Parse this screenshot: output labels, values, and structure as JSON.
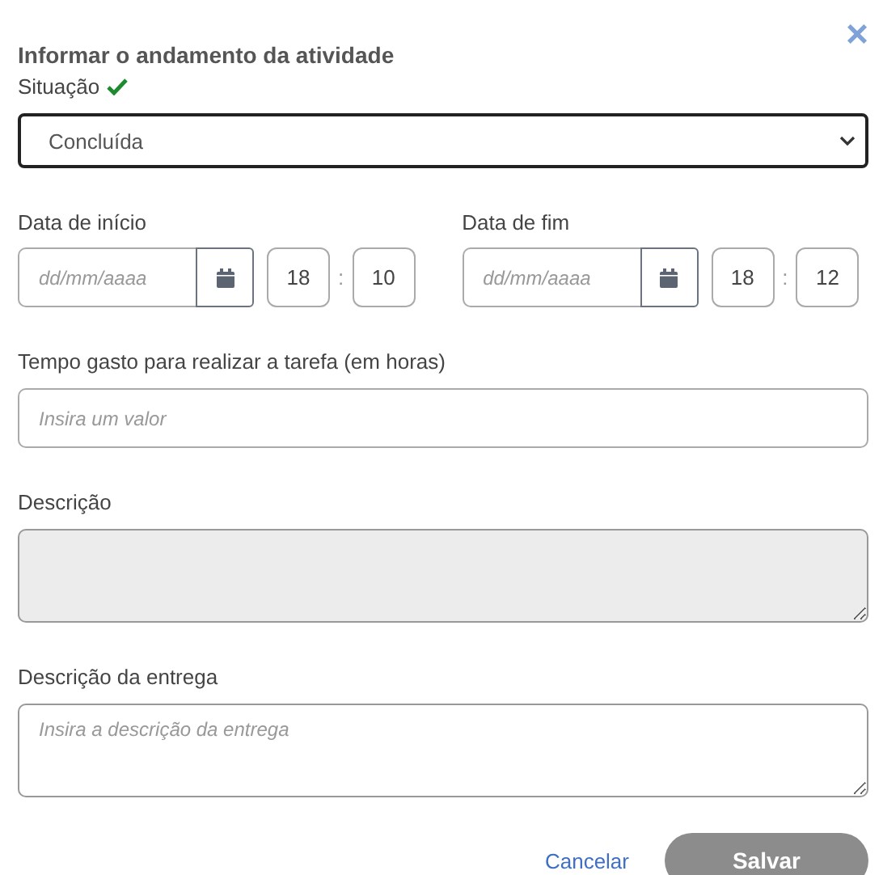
{
  "dialog": {
    "title": "Informar o andamento da atividade",
    "close": "×"
  },
  "status": {
    "label": "Situação",
    "valid": true,
    "value": "Concluída"
  },
  "dates": [
    {
      "label": "Data de início",
      "placeholder": "dd/mm/aaaa",
      "hour": "18",
      "separator": ":",
      "minute": "10"
    },
    {
      "label": "Data de fim",
      "placeholder": "dd/mm/aaaa",
      "hour": "18",
      "separator": ":",
      "minute": "12"
    }
  ],
  "fields": [
    {
      "kind": "input",
      "label": "Tempo gasto para realizar a tarefa (em horas)",
      "placeholder": "Insira um valor",
      "disabled": false
    },
    {
      "kind": "textarea",
      "label": "Descrição",
      "disabled": true
    },
    {
      "kind": "textarea",
      "label": "Descrição da entrega",
      "placeholder": "Insira a descrição da entrega",
      "disabled": false
    }
  ],
  "buttons": [
    {
      "kind": "link",
      "label": "Cancelar",
      "disabled": false
    },
    {
      "kind": "primary",
      "label": "Salvar",
      "disabled": true
    }
  ]
}
